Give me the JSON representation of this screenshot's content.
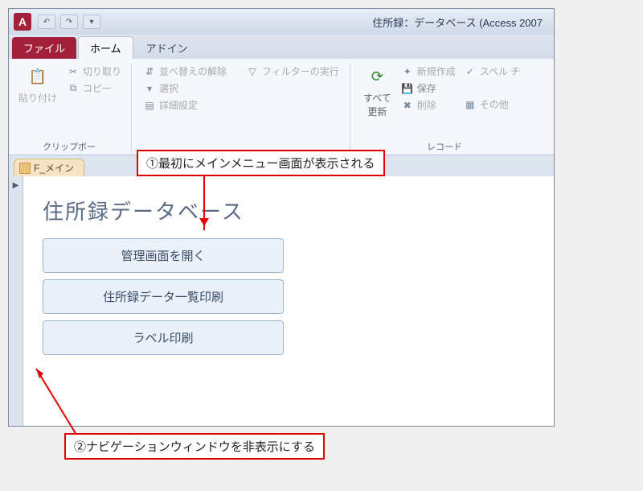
{
  "titlebar": {
    "app_letter": "A",
    "title": "住所録：データベース (Access 2007"
  },
  "tabs": {
    "file": "ファイル",
    "home": "ホーム",
    "addin": "アドイン"
  },
  "ribbon": {
    "clipboard": {
      "paste": "貼り付け",
      "cut": "切り取り",
      "copy": "コピー",
      "group_label": "クリップボー"
    },
    "sort": {
      "clear_sort": "並べ替えの解除",
      "select": "選択",
      "advanced": "詳細設定",
      "run_filter": "フィルターの実行"
    },
    "records": {
      "refresh": "すべて\n更新",
      "new": "新規作成",
      "save": "保存",
      "delete": "削除",
      "other": "その他",
      "spell": "スペル チ",
      "group_label": "レコード"
    }
  },
  "doc_tab": {
    "label": "F_メイン"
  },
  "form": {
    "title": "住所録データベース",
    "btn1": "管理画面を開く",
    "btn2": "住所録データ一覧印刷",
    "btn3": "ラベル印刷"
  },
  "callouts": {
    "c1": "①最初にメインメニュー画面が表示される",
    "c2": "②ナビゲーションウィンドウを非表示にする"
  }
}
